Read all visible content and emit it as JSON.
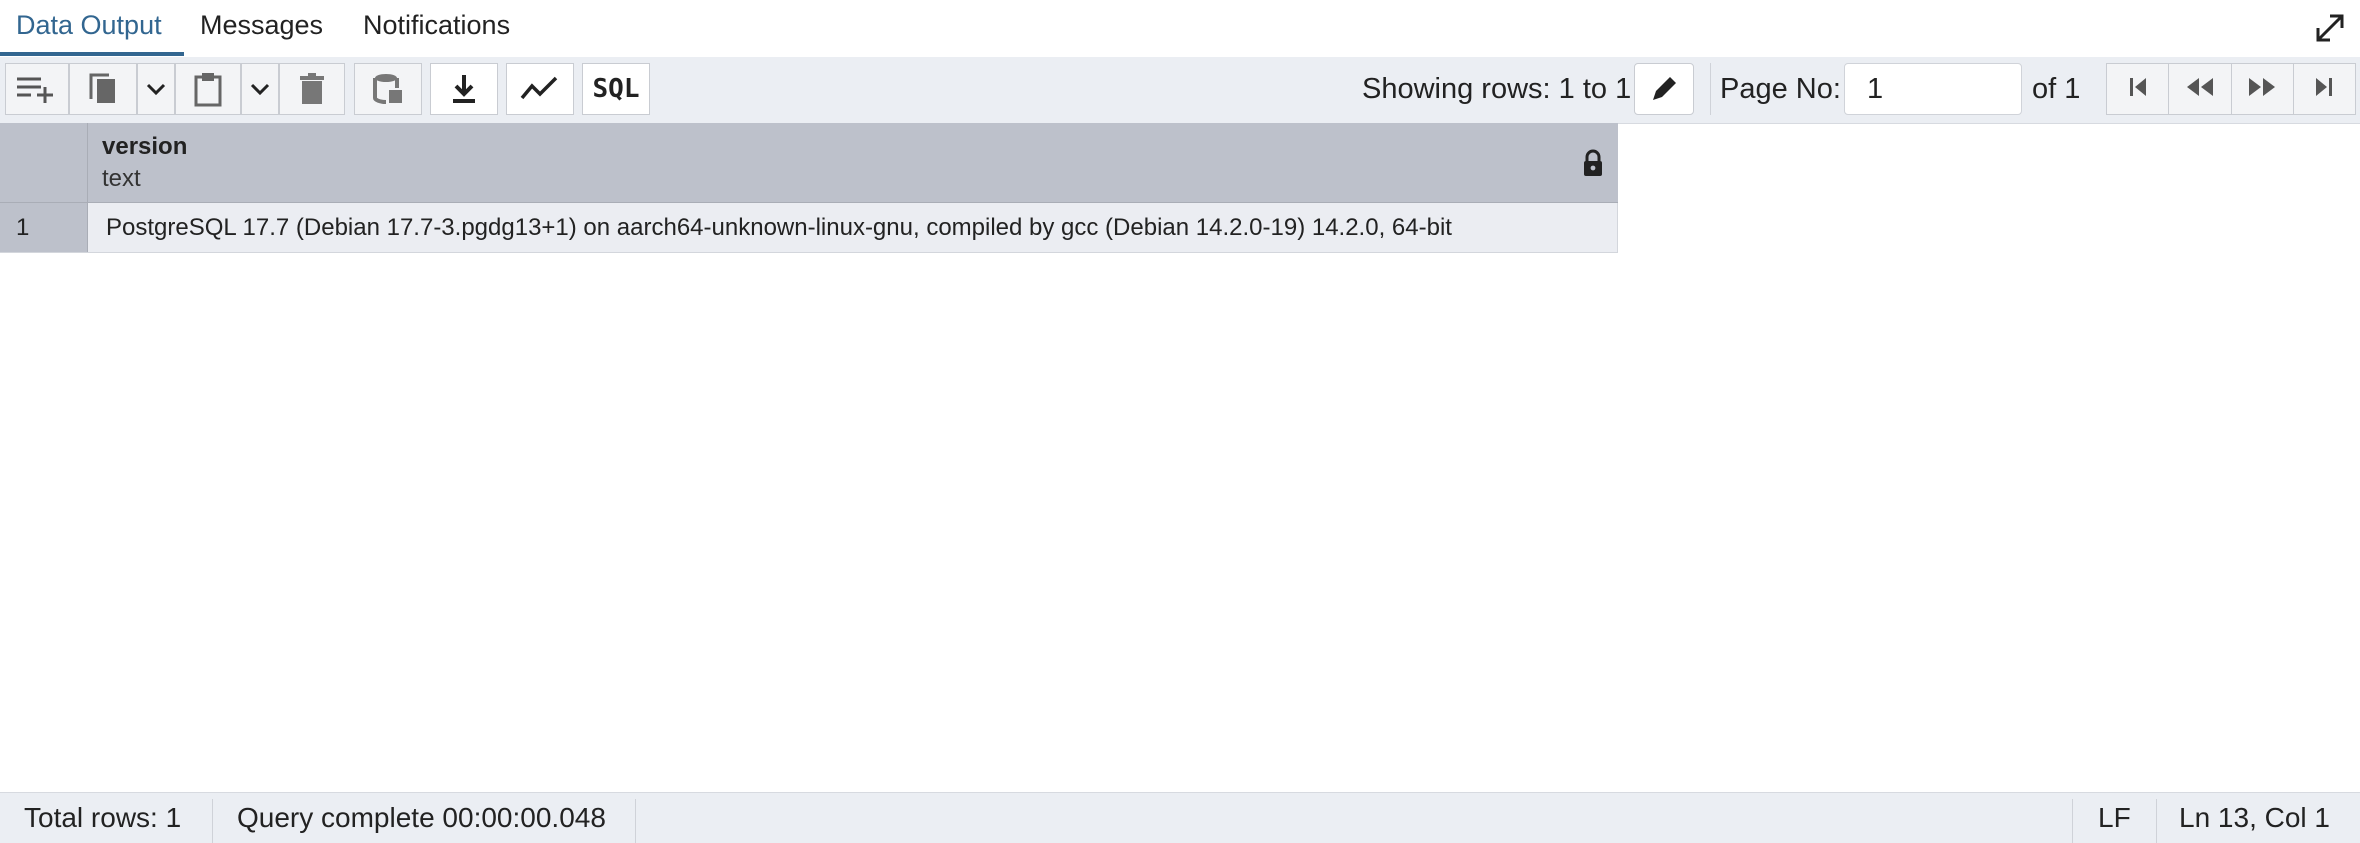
{
  "tabs": [
    {
      "label": "Data Output",
      "active": true
    },
    {
      "label": "Messages",
      "active": false
    },
    {
      "label": "Notifications",
      "active": false
    }
  ],
  "toolbar": {
    "buttons": [
      "add-row-icon",
      "copy-icon",
      "chevron-down-icon",
      "paste-icon",
      "chevron-down-icon",
      "delete-icon",
      "save-data-icon",
      "download-icon",
      "graph-icon"
    ],
    "sql_label": "SQL",
    "showing_rows": "Showing rows: 1 to 1",
    "page_no_label": "Page No:",
    "page_no_value": "1",
    "page_of": "of 1"
  },
  "grid": {
    "columns": [
      {
        "name": "version",
        "type": "text",
        "locked": true
      }
    ],
    "rows": [
      {
        "num": "1",
        "values": [
          "PostgreSQL 17.7 (Debian 17.7-3.pgdg13+1) on aarch64-unknown-linux-gnu, compiled by gcc (Debian 14.2.0-19) 14.2.0, 64-bit"
        ]
      }
    ]
  },
  "status": {
    "total_rows": "Total rows: 1",
    "query_complete": "Query complete 00:00:00.048",
    "line_ending": "LF",
    "cursor": "Ln 13, Col 1"
  },
  "colors": {
    "accent": "#326690",
    "header_bg": "#bdc1cb",
    "toolbar_bg": "#ebeef3"
  }
}
